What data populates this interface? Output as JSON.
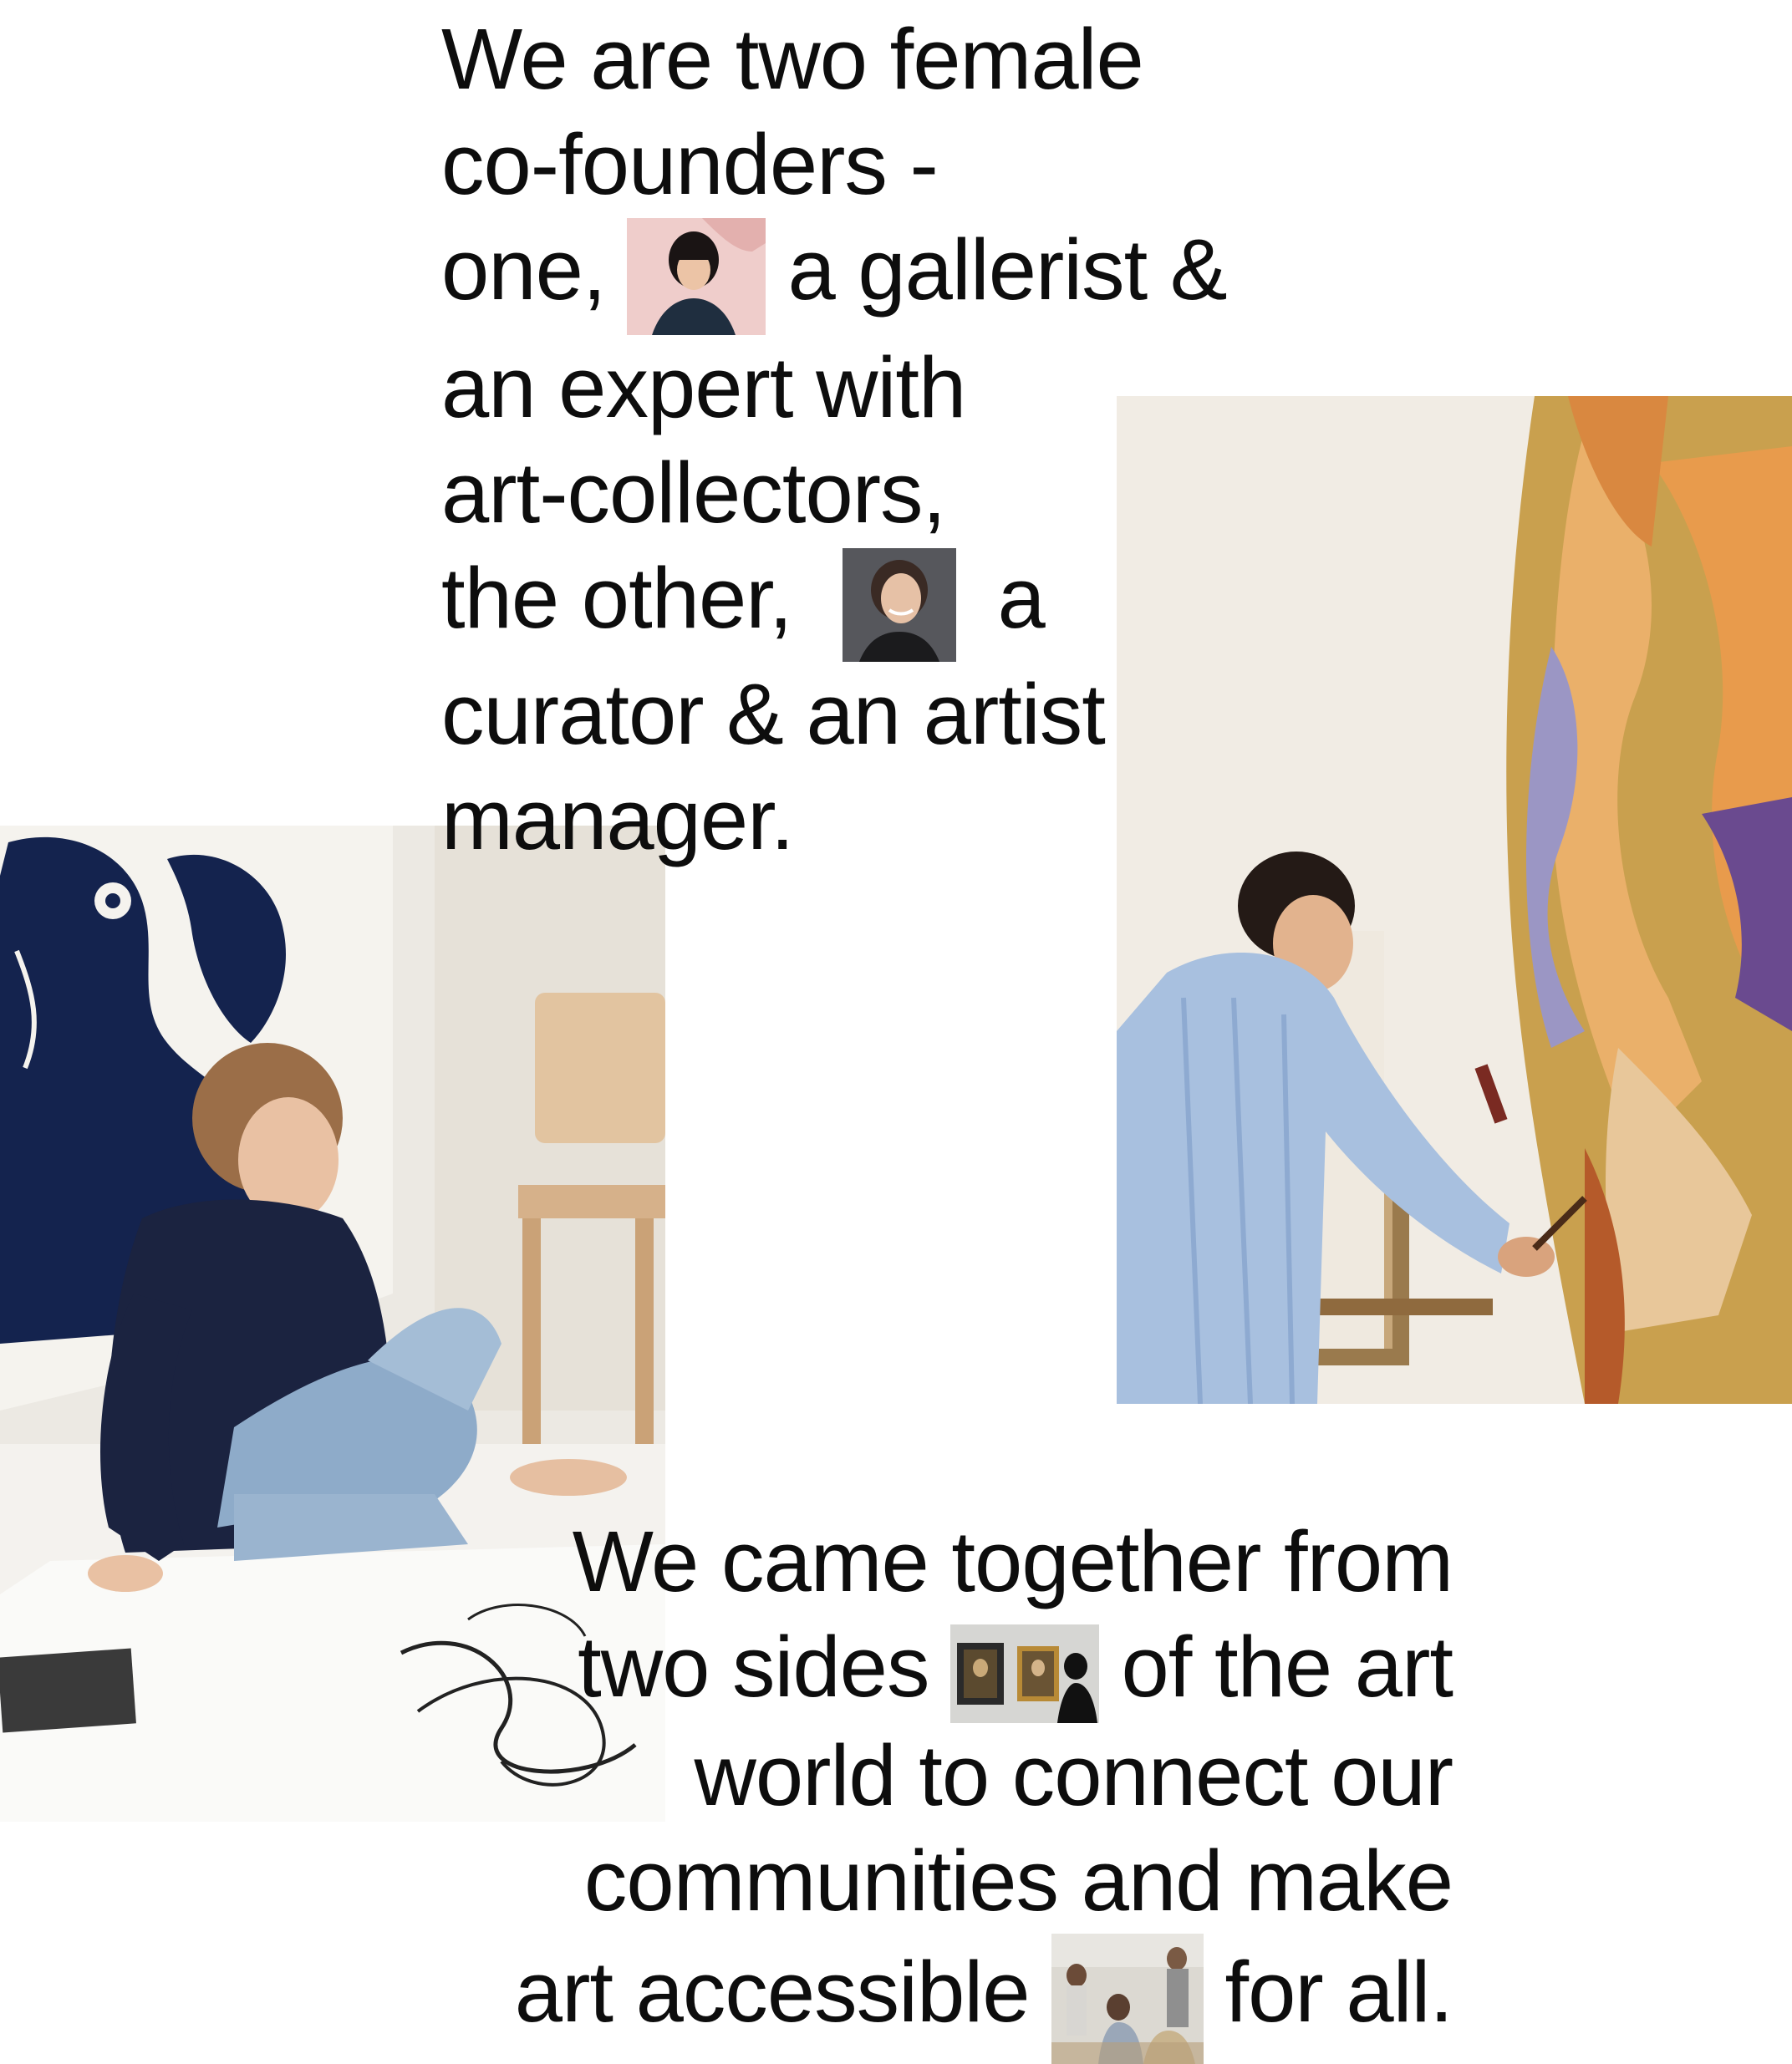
{
  "intro": {
    "line1": "We are two female",
    "line2": "co-founders -",
    "line3_before": "one,",
    "line3_after": "a gallerist &",
    "line4": "an expert with",
    "line5": "art-collectors,",
    "line6_before": "the other,",
    "line6_after": "a",
    "line7": "curator & an artist",
    "line8": "manager."
  },
  "story": {
    "line1": "We came together from",
    "line2_before": "two sides",
    "line2_after": "of the art",
    "line3": "world to connect our",
    "line4": "communities and make",
    "line5_before": "art accessible",
    "line5_after": "for all."
  },
  "colors": {
    "text": "#0d0d0d",
    "background": "#ffffff"
  },
  "icons": {
    "gallerist": "gallerist-portrait-icon",
    "curator": "curator-portrait-icon",
    "gallery": "gallery-paintings-icon",
    "community": "community-gathering-icon"
  }
}
